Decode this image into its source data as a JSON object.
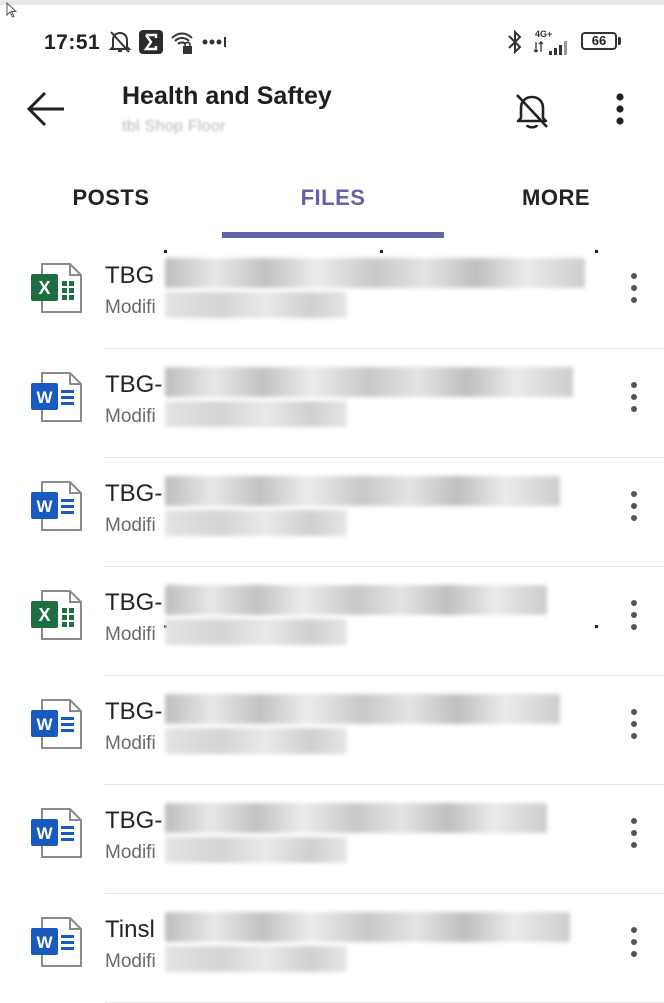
{
  "status_bar": {
    "time": "17:51",
    "network_label": "4G+",
    "battery": "66",
    "icons": [
      "mute-bell-icon",
      "sigma-app-icon",
      "wifi-lock-icon",
      "more-dots-icon",
      "bluetooth-icon",
      "signal-icon",
      "battery-icon"
    ]
  },
  "header": {
    "title": "Health and Saftey",
    "subtitle": "tbl Shop Floor",
    "icons": [
      "back-arrow-icon",
      "mute-bell-icon",
      "more-vertical-icon"
    ]
  },
  "tabs": {
    "items": [
      {
        "label": "POSTS"
      },
      {
        "label": "FILES"
      },
      {
        "label": "MORE"
      }
    ],
    "active": "FILES",
    "accent_color": "#6264a7"
  },
  "files": {
    "items": [
      {
        "type": "excel",
        "name": "TBG ",
        "meta": "Modifi"
      },
      {
        "type": "word",
        "name": "TBG-",
        "meta": "Modifi"
      },
      {
        "type": "word",
        "name": "TBG-",
        "meta": "Modifi"
      },
      {
        "type": "excel",
        "name": "TBG-",
        "meta": "Modifi"
      },
      {
        "type": "word",
        "name": "TBG-",
        "meta": "Modifi"
      },
      {
        "type": "word",
        "name": "TBG-",
        "meta": "Modifi"
      },
      {
        "type": "word",
        "name": "Tinsl",
        "meta": "Modifi"
      }
    ],
    "colors": {
      "excel": "#1d6f42",
      "word": "#185abd"
    }
  }
}
